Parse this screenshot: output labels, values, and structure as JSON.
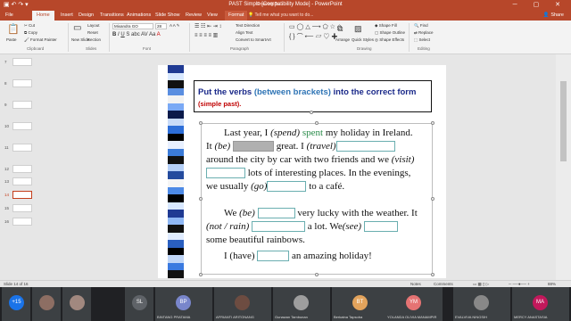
{
  "window": {
    "title": "PAST Simple [Compatibility Mode] - PowerPoint",
    "tool_context": "Drawing To..."
  },
  "tabs": [
    "File",
    "Home",
    "Insert",
    "Design",
    "Transitions",
    "Animations",
    "Slide Show",
    "Review",
    "View",
    "Format"
  ],
  "tell_me": "Tell me what you want to do...",
  "share": "Share",
  "ribbon": {
    "clipboard": {
      "paste": "Paste",
      "cut": "Cut",
      "copy": "Copy",
      "format_painter": "Format Painter",
      "label": "Clipboard"
    },
    "slides": {
      "new_slide": "New Slide",
      "layout": "Layout",
      "reset": "Reset",
      "section": "Section",
      "label": "Slides"
    },
    "font": {
      "family": "Mixandra GO",
      "size": "28",
      "label": "Font"
    },
    "paragraph": {
      "text_direction": "Text Direction",
      "align_text": "Align Text",
      "convert": "Convert to SmartArt",
      "label": "Paragraph"
    },
    "drawing": {
      "shape_fill": "Shape Fill",
      "shape_outline": "Shape Outline",
      "shape_effects": "Shape Effects",
      "arrange": "Arrange",
      "quick_styles": "Quick Styles",
      "label": "Drawing"
    },
    "editing": {
      "find": "Find",
      "replace": "Replace",
      "select": "Select",
      "label": "Editing"
    }
  },
  "thumbnails": [
    "7",
    "8",
    "9",
    "10",
    "11",
    "12",
    "13",
    "14",
    "15",
    "16"
  ],
  "current_slide": "14",
  "slide": {
    "instruction_a": "Put the verbs ",
    "instruction_b": "(between brackets)",
    "instruction_c": " into the correct form ",
    "instruction_d": "(simple past).",
    "p1_a": "Last year, I ",
    "p1_b": "(spend)",
    "p1_ans": "spent",
    "p1_c": " my holiday in Ireland. It ",
    "p1_d": "(be)",
    "p1_e": " great. I ",
    "p1_f": "(travel)",
    "p1_g": " around the city by car with two friends and we ",
    "p1_h": "(visit)",
    "p1_i": " lots of interesting places. In the evenings, we usually ",
    "p1_j": "(go)",
    "p1_k": " to a café.",
    "p2_a": "We ",
    "p2_b": "(be)",
    "p2_c": " very lucky with the weather. It ",
    "p2_d": "(not / rain)",
    "p2_e": " a lot. We",
    "p2_f": "(see)",
    "p2_g": " some beautiful rainbows.",
    "p3_a": "I (have) ",
    "p3_b": " an amazing holiday!"
  },
  "status": {
    "slide_of": "Slide 14 of 16",
    "notes": "Notes",
    "comments": "Comments",
    "zoom": "88%"
  },
  "participants": [
    {
      "initials": "+15",
      "name": "",
      "color": "#1a73e8"
    },
    {
      "initials": "",
      "name": "",
      "color": "#8d6e63"
    },
    {
      "initials": "",
      "name": "",
      "color": "#a1887f"
    },
    {
      "initials": "SL",
      "name": "",
      "color": "#5f6368"
    },
    {
      "initials": "BP",
      "name": "BINTANG PRATAMA",
      "color": "#7986cb"
    },
    {
      "initials": "",
      "name": "AFRIANTI ARITONANG",
      "color": "#6d4c41"
    },
    {
      "initials": "",
      "name": "Gunawan Tambunan",
      "color": "#9e9e9e"
    },
    {
      "initials": "BT",
      "name": "Berkatna Tapsoba",
      "color": "#e2a35c"
    },
    {
      "initials": "YM",
      "name": "YOLANDA OLIVIA MANAMPIR",
      "color": "#e57373"
    },
    {
      "initials": "",
      "name": "EVALVIVA NINGSIH",
      "color": "#888"
    },
    {
      "initials": "MA",
      "name": "MERCY ANASTASIA",
      "color": "#c2185b"
    }
  ],
  "colors": {
    "brand": "#b7472a",
    "instruction": "#1b2a8a",
    "highlight": "#2e74b5",
    "answer": "#2a8c4a"
  }
}
